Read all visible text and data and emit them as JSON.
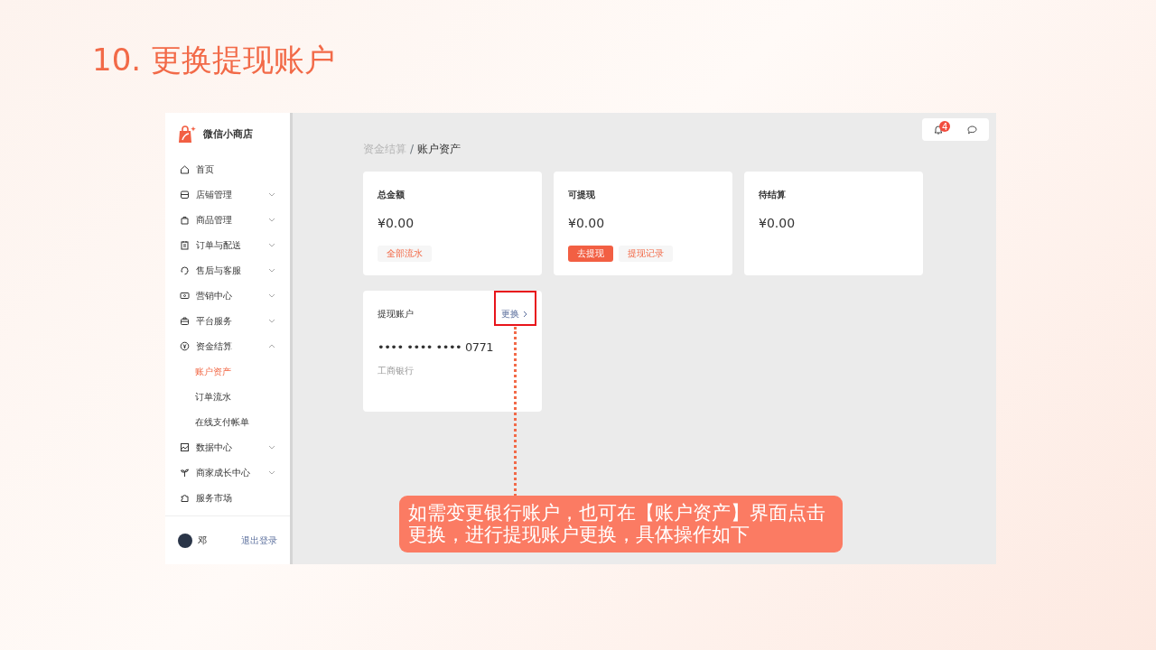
{
  "slide": {
    "title": "10. 更换提现账户"
  },
  "sidebar": {
    "brand": "微信小商店",
    "items": [
      {
        "label": "首页"
      },
      {
        "label": "店铺管理",
        "expanded": false
      },
      {
        "label": "商品管理",
        "expanded": false
      },
      {
        "label": "订单与配送",
        "expanded": false
      },
      {
        "label": "售后与客服",
        "expanded": false
      },
      {
        "label": "营销中心",
        "expanded": false
      },
      {
        "label": "平台服务",
        "expanded": false
      },
      {
        "label": "资金结算",
        "expanded": true,
        "children": [
          {
            "label": "账户资产",
            "selected": true
          },
          {
            "label": "订单流水",
            "selected": false
          },
          {
            "label": "在线支付帐单",
            "selected": false
          }
        ]
      },
      {
        "label": "数据中心",
        "expanded": false
      },
      {
        "label": "商家成长中心",
        "expanded": false
      },
      {
        "label": "服务市场"
      }
    ],
    "user": {
      "name": "邓",
      "logout": "退出登录"
    }
  },
  "header": {
    "notification_count": "4"
  },
  "breadcrumb": {
    "items": [
      "资金结算",
      "账户资产"
    ],
    "separator": "/"
  },
  "cards": [
    {
      "title": "总金额",
      "amount": "¥0.00",
      "buttons": [
        {
          "label": "全部流水",
          "kind": "light"
        }
      ]
    },
    {
      "title": "可提现",
      "amount": "¥0.00",
      "buttons": [
        {
          "label": "去提现",
          "kind": "primary"
        },
        {
          "label": "提现记录",
          "kind": "light"
        }
      ]
    },
    {
      "title": "待结算",
      "amount": "¥0.00"
    }
  ],
  "account": {
    "title": "提现账户",
    "action": "更换",
    "number": "•••• •••• •••• 0771",
    "bank": "工商银行"
  },
  "callout": {
    "text": "如需变更银行账户，也可在【账户资产】界面点击更换，进行提现账户更换，具体操作如下"
  }
}
